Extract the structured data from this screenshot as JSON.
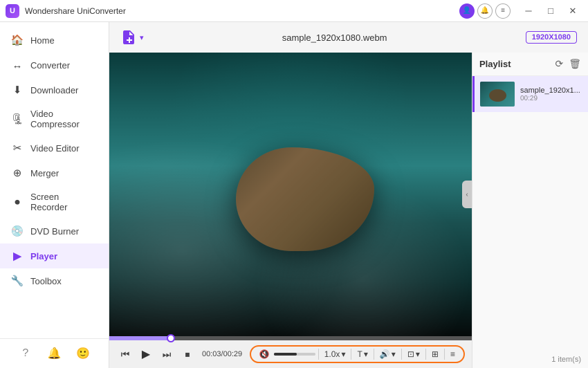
{
  "titleBar": {
    "appName": "Wondershare UniConverter",
    "windowButtons": [
      "minimize",
      "maximize",
      "close"
    ]
  },
  "sidebar": {
    "items": [
      {
        "id": "home",
        "label": "Home",
        "icon": "🏠",
        "active": false
      },
      {
        "id": "converter",
        "label": "Converter",
        "icon": "↔",
        "active": false
      },
      {
        "id": "downloader",
        "label": "Downloader",
        "icon": "⬇",
        "active": false
      },
      {
        "id": "video-compressor",
        "label": "Video Compressor",
        "icon": "🗜",
        "active": false
      },
      {
        "id": "video-editor",
        "label": "Video Editor",
        "icon": "✂",
        "active": false
      },
      {
        "id": "merger",
        "label": "Merger",
        "icon": "⊕",
        "active": false
      },
      {
        "id": "screen-recorder",
        "label": "Screen Recorder",
        "icon": "⏺",
        "active": false
      },
      {
        "id": "dvd-burner",
        "label": "DVD Burner",
        "icon": "💿",
        "active": false
      },
      {
        "id": "player",
        "label": "Player",
        "icon": "▶",
        "active": true
      },
      {
        "id": "toolbox",
        "label": "Toolbox",
        "icon": "🔧",
        "active": false
      }
    ],
    "bottomIcons": [
      "?",
      "🔔",
      "😊"
    ]
  },
  "toolbar": {
    "filename": "sample_1920x1080.webm",
    "resolution": "1920X1080"
  },
  "player": {
    "currentTime": "00:03",
    "totalTime": "00:29",
    "progressPercent": 17
  },
  "controls": {
    "prevLabel": "⏮",
    "playLabel": "▶",
    "nextLabel": "⏭",
    "stopLabel": "⏹",
    "timeDisplay": "00:03/00:29",
    "volumeIcon": "🔇",
    "speedLabel": "1.0x",
    "captionLabel": "T",
    "audioLabel": "🔊",
    "cropLabel": "⊡",
    "snapshotLabel": "⊞",
    "menuLabel": "≡"
  },
  "playlist": {
    "title": "Playlist",
    "items": [
      {
        "name": "sample_1920x1...",
        "duration": "00:29"
      }
    ],
    "itemCount": "1 item(s)"
  }
}
